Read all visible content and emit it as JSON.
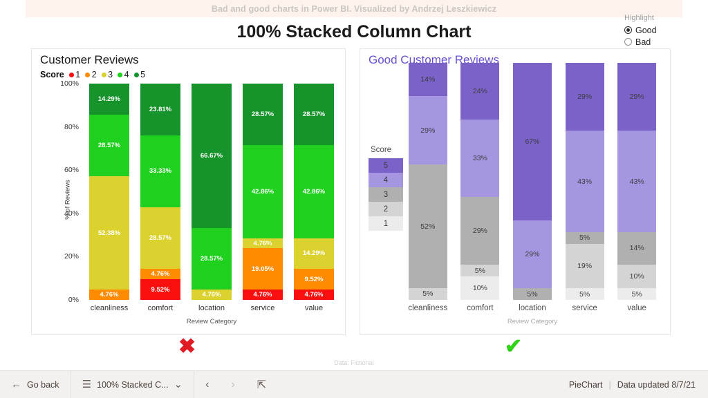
{
  "banner": {
    "text": "Bad and good charts in Power BI. Visualized by Andrzej Leszkiewicz"
  },
  "page": {
    "title": "100% Stacked Column Chart",
    "footnote": "Data: Fictional"
  },
  "slicer": {
    "title": "Highlight",
    "options": [
      {
        "label": "Good",
        "selected": true
      },
      {
        "label": "Bad",
        "selected": false
      }
    ]
  },
  "bad_panel": {
    "title": "Customer Reviews",
    "legend_title": "Score",
    "verdict_icon": "cross-mark-icon",
    "verdict": "✖"
  },
  "good_panel": {
    "title": "Good Customer Reviews",
    "legend_title": "Score",
    "verdict_icon": "check-mark-icon",
    "verdict": "✔"
  },
  "statusbar": {
    "back_label": "Go back",
    "back_icon": "arrow-left-icon",
    "page_name": "100% Stacked C...",
    "page_menu_icon": "hamburger-icon",
    "page_dropdown_icon": "chevron-down-icon",
    "prev_icon": "chevron-left-icon",
    "next_icon": "chevron-right-icon",
    "fit_icon": "fit-to-screen-icon",
    "report_name": "PieChart",
    "separator": "|",
    "updated": "Data updated 8/7/21"
  },
  "chart_data": [
    {
      "id": "bad",
      "type": "bar",
      "stacked": "100%",
      "title": "Customer Reviews",
      "xlabel": "Review Category",
      "ylabel": "% of Reviews",
      "ylim": [
        0,
        100
      ],
      "yticks": [
        "0%",
        "20%",
        "40%",
        "60%",
        "80%",
        "100%"
      ],
      "legend_title": "Score",
      "legend_position": "top",
      "grid": false,
      "categories": [
        "cleanliness",
        "comfort",
        "location",
        "service",
        "value"
      ],
      "series": [
        {
          "name": "1",
          "color": "#fa0f0f",
          "values": [
            0,
            9.52,
            0,
            4.76,
            4.76
          ],
          "labels": [
            "",
            "9.52%",
            "",
            "4.76%",
            "4.76%"
          ]
        },
        {
          "name": "2",
          "color": "#ff8c00",
          "values": [
            4.76,
            4.76,
            0,
            19.05,
            9.52
          ],
          "labels": [
            "4.76%",
            "4.76%",
            "",
            "19.05%",
            "9.52%"
          ]
        },
        {
          "name": "3",
          "color": "#dbd12f",
          "values": [
            52.38,
            28.57,
            4.76,
            4.76,
            14.29
          ],
          "labels": [
            "52.38%",
            "28.57%",
            "4.76%",
            "4.76%",
            "14.29%"
          ]
        },
        {
          "name": "4",
          "color": "#1fd01f",
          "values": [
            28.57,
            33.33,
            28.57,
            42.86,
            42.86
          ],
          "labels": [
            "28.57%",
            "33.33%",
            "28.57%",
            "42.86%",
            "42.86%"
          ]
        },
        {
          "name": "5",
          "color": "#16932b",
          "values": [
            14.29,
            23.81,
            66.67,
            28.57,
            28.57
          ],
          "labels": [
            "14.29%",
            "23.81%",
            "66.67%",
            "28.57%",
            "28.57%"
          ]
        }
      ]
    },
    {
      "id": "good",
      "type": "bar",
      "stacked": "100%",
      "title": "Good Customer Reviews",
      "xlabel": "Review Category",
      "ylabel": "",
      "ylim": [
        0,
        100
      ],
      "yticks": [],
      "legend_title": "Score",
      "legend_position": "left",
      "grid": false,
      "categories": [
        "cleanliness",
        "comfort",
        "location",
        "service",
        "value"
      ],
      "series": [
        {
          "name": "1",
          "color": "#ececec",
          "values": [
            0,
            10,
            0,
            5,
            5
          ],
          "labels": [
            "",
            "10%",
            "",
            "5%",
            "5%"
          ]
        },
        {
          "name": "2",
          "color": "#d4d4d4",
          "values": [
            5,
            5,
            0,
            19,
            10
          ],
          "labels": [
            "5%",
            "5%",
            "",
            "19%",
            "10%"
          ]
        },
        {
          "name": "3",
          "color": "#b0b0b0",
          "values": [
            52,
            29,
            5,
            5,
            14
          ],
          "labels": [
            "52%",
            "29%",
            "5%",
            "5%",
            "14%"
          ]
        },
        {
          "name": "4",
          "color": "#a695e0",
          "values": [
            29,
            33,
            29,
            43,
            43
          ],
          "labels": [
            "29%",
            "33%",
            "29%",
            "43%",
            "43%"
          ]
        },
        {
          "name": "5",
          "color": "#7b62c9",
          "values": [
            14,
            24,
            67,
            29,
            29
          ],
          "labels": [
            "14%",
            "24%",
            "67%",
            "29%",
            "29%"
          ]
        }
      ]
    }
  ]
}
